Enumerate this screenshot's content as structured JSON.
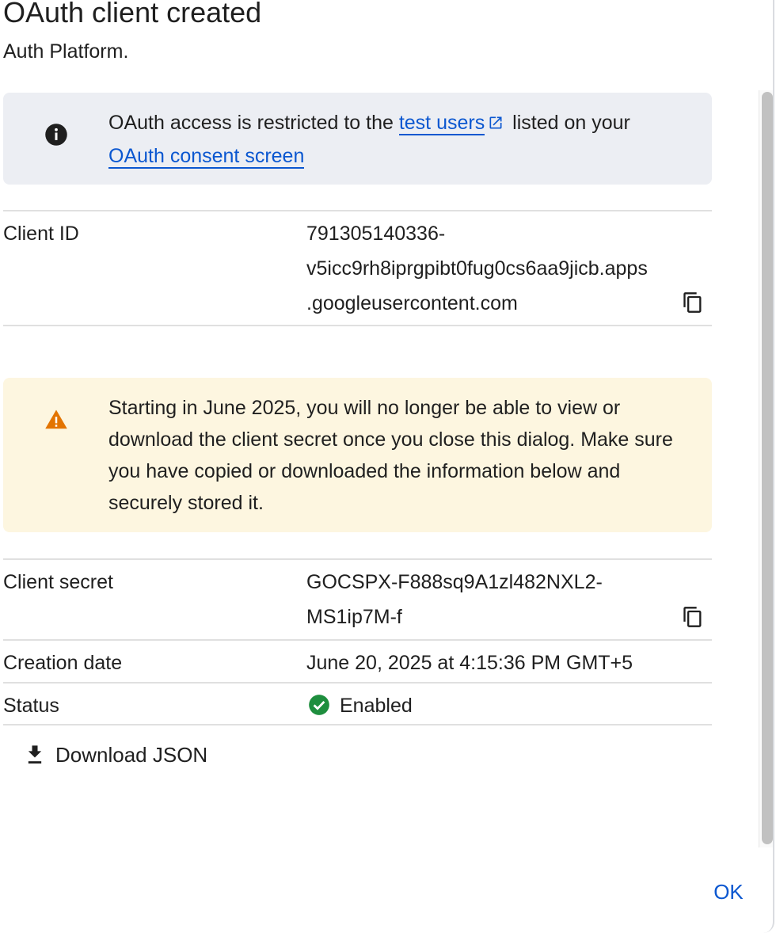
{
  "dialog": {
    "title": "OAuth client created",
    "subtitle_fragment": "Auth Platform."
  },
  "info_banner": {
    "text_before_link": "OAuth access is restricted to the ",
    "test_users_link": "test users",
    "text_after_link": " listed on your ",
    "consent_screen_link": "OAuth consent screen",
    "icon": "info-icon",
    "link_color": "#0b57d0"
  },
  "client_id": {
    "label": "Client ID",
    "value": "791305140336-v5icc9rh8iprgpibt0fug0cs6aa9jicb.apps.googleusercontent.com",
    "lines": [
      "791305140336-",
      "v5icc9rh8iprgpibt0fug0cs6aa9jicb.apps",
      ".googleusercontent.com"
    ]
  },
  "warning_banner": {
    "text": "Starting in June 2025, you will no longer be able to view or download the client secret once you close this dialog. Make sure you have copied or downloaded the information below and securely stored it.",
    "icon": "warning-icon",
    "icon_color": "#e37400",
    "background": "#fdf6e0"
  },
  "client_secret": {
    "label": "Client secret",
    "lines": [
      "GOCSPX-F888sq9A1zl482NXL2-",
      "MS1ip7M-f"
    ]
  },
  "creation_date": {
    "label": "Creation date",
    "value": "June 20, 2025 at 4:15:36 PM GMT+5"
  },
  "status": {
    "label": "Status",
    "value": "Enabled",
    "icon": "check-circle-icon",
    "icon_color": "#1e8e3e"
  },
  "actions": {
    "download_label": "Download JSON",
    "ok_label": "OK"
  }
}
